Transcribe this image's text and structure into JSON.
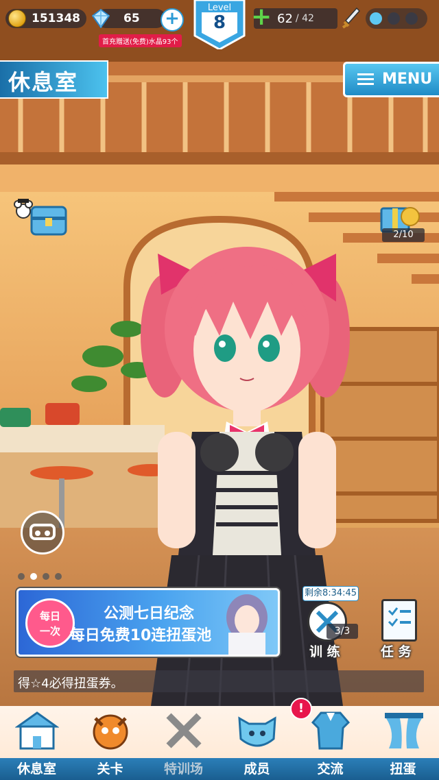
{
  "currency": {
    "gold": "151348",
    "crystals": "65",
    "promo_text": "首充赠送(免费)水晶93个"
  },
  "level": {
    "label": "Level",
    "value": "8"
  },
  "stamina": {
    "current": "62",
    "max": "/ 42"
  },
  "room": {
    "title": "休息室"
  },
  "menu": {
    "label": "MENU"
  },
  "gift": {
    "count": "2/10"
  },
  "banner": {
    "badge_line1": "每日",
    "badge_line2": "一次",
    "line1": "公测七日纪念",
    "line2": "每日免费10连扭蛋池"
  },
  "training": {
    "timer": "剩余8:34:45",
    "count": "3/3",
    "label": "训 练"
  },
  "task": {
    "label": "任 务"
  },
  "notice": {
    "text": "得☆4必得扭蛋券。"
  },
  "nav": {
    "items": [
      {
        "label": "休息室",
        "icon": "building-icon"
      },
      {
        "label": "关卡",
        "icon": "monster-icon"
      },
      {
        "label": "特训场",
        "icon": "crossed-swords-icon"
      },
      {
        "label": "成员",
        "icon": "cat-face-icon"
      },
      {
        "label": "交流",
        "icon": "uniform-icon"
      },
      {
        "label": "扭蛋",
        "icon": "curtain-icon"
      }
    ],
    "alert": "!"
  },
  "colors": {
    "accent": "#2b9bd6",
    "nav_bar": "#1a5e90",
    "alert": "#e8164d",
    "banner": "#2c67d6"
  }
}
